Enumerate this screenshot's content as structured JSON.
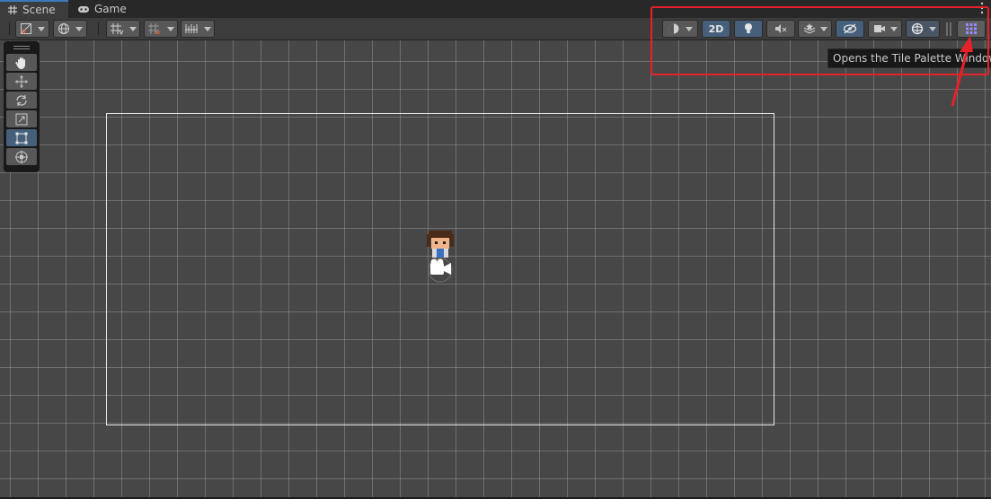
{
  "tabs": [
    {
      "label": "Scene",
      "icon": "hash-grid-icon",
      "active": true
    },
    {
      "label": "Game",
      "icon": "gamepad-icon",
      "active": false
    }
  ],
  "toolbar": {
    "mode_2d_label": "2D",
    "left_buttons": [
      "draw-mode-icon",
      "global-icon",
      "grid-snap-icon",
      "grid-visibility-icon",
      "increment-snap-icon"
    ],
    "right_buttons": [
      "shading-icon",
      "2d-toggle",
      "lighting-icon",
      "audio-mute-icon",
      "effects-icon",
      "hidden-objects-icon",
      "camera-icon",
      "gizmos-icon",
      "tile-palette-icon"
    ]
  },
  "tools": [
    "hand-tool-icon",
    "move-tool-icon",
    "rotate-tool-icon",
    "scale-tool-icon",
    "rect-tool-icon",
    "transform-tool-icon"
  ],
  "tooltip": {
    "text": "Opens the Tile Palette Window"
  },
  "colors": {
    "accent_blue": "#46607c",
    "scene_bg": "#474747",
    "annotation_red": "#e6212a",
    "tile_palette_purple": "#9a88ff"
  }
}
